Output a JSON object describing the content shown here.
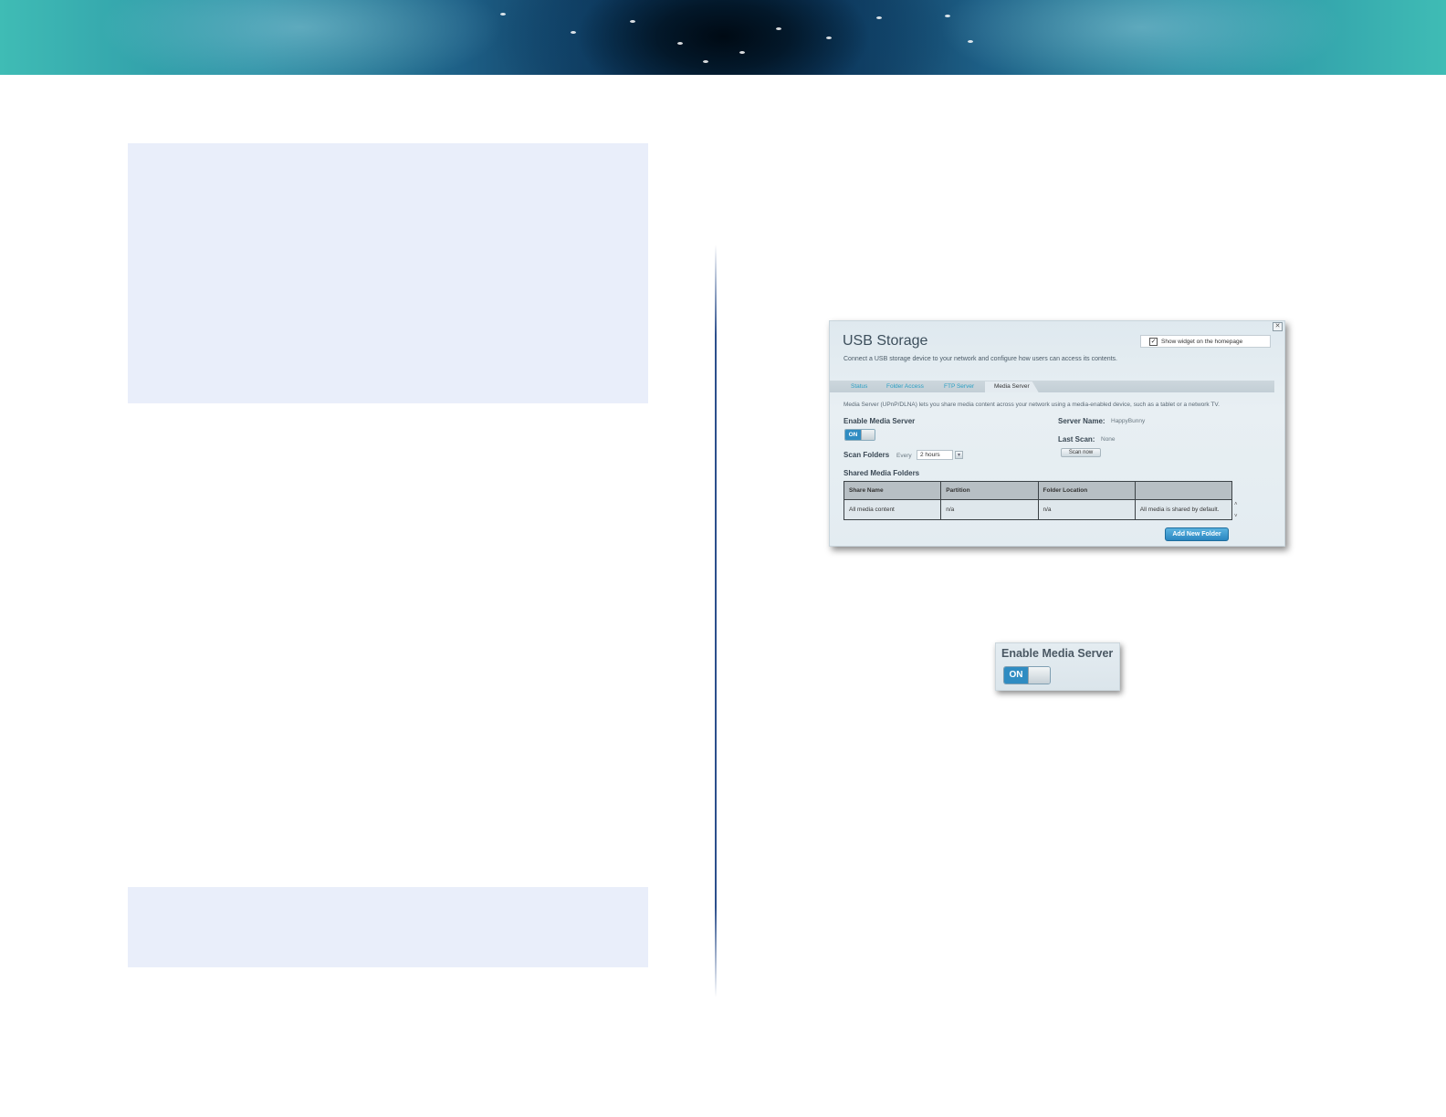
{
  "widget": {
    "title": "USB Storage",
    "description": "Connect a USB storage device to your network and configure how users can access its contents.",
    "show_widget_label": "Show widget on the homepage",
    "close_glyph": "✕",
    "tabs": [
      {
        "label": "Status"
      },
      {
        "label": "Folder Access"
      },
      {
        "label": "FTP Server"
      },
      {
        "label": "Media Server"
      }
    ],
    "intro": "Media Server (UPnP/DLNA) lets you share media content across your network using a media-enabled device, such as a tablet or a network TV.",
    "enable_label": "Enable Media Server",
    "toggle_state": "ON",
    "scan_folders_label": "Scan Folders",
    "every_label": "Every",
    "every_value": "2 hours",
    "server_name_label": "Server Name:",
    "server_name_value": "HappyBunny",
    "last_scan_label": "Last Scan:",
    "last_scan_value": "None",
    "scan_now_label": "Scan now",
    "shared_folders_label": "Shared Media Folders",
    "table": {
      "headers": [
        "Share Name",
        "Partition",
        "Folder Location",
        ""
      ],
      "rows": [
        [
          "All media content",
          "n/a",
          "n/a",
          "All media is shared by default."
        ]
      ]
    },
    "add_folder_label": "Add New Folder"
  },
  "callout": {
    "title": "Enable Media Server",
    "toggle_state": "ON"
  },
  "colors": {
    "accent": "#2f8cc2",
    "panel": "#e9eefa",
    "divider": "#2c4f8c"
  }
}
